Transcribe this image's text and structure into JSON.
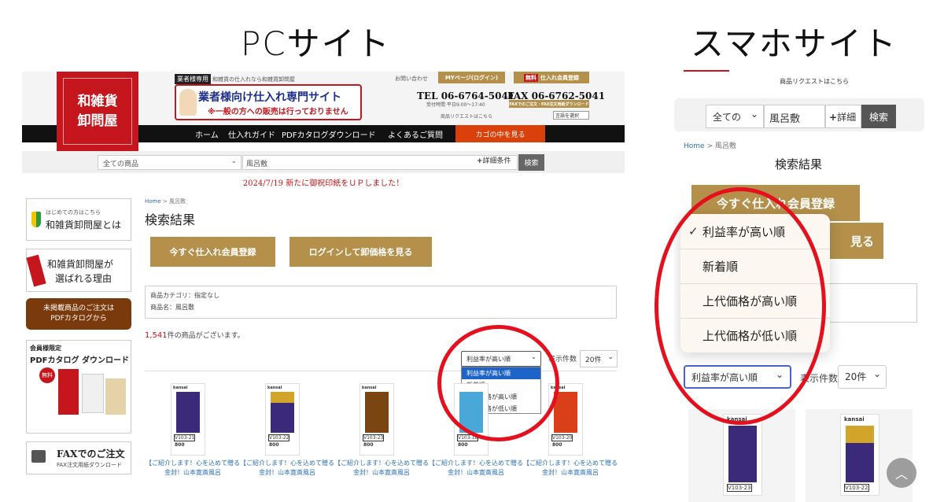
{
  "headings": {
    "pc": "PCサイト",
    "mobile": "スマホサイト"
  },
  "pc": {
    "logo": {
      "line1": "和雑貨",
      "line2": "卸問屋"
    },
    "header": {
      "badge": "業者様専用",
      "tagline": "和雑貨の仕入れなら和雑貨卸問屋",
      "banner_title": "業者様向け仕入れ専門サイト",
      "banner_sub": "※一般の方への販売は行っておりません",
      "inquiry": "お問い合わせ",
      "mypage_button": "MYページ(ログイン)",
      "register_button": "仕入れ会員登録",
      "free_badge": "無料",
      "tel": "TEL 06-6764-5041",
      "fax": "FAX 06-6762-5041",
      "hours": "受付時間 平日9:00〜17:40",
      "fax_order": "FAXでのご注文・FAX注文用紙ダウンロード",
      "request": "商品リクエストはこちら",
      "language": "言語を選択"
    },
    "nav": [
      "ホーム",
      "仕入れガイド",
      "PDFカタログダウンロード",
      "よくあるご質問"
    ],
    "cart_button": "カゴの中を見る",
    "search": {
      "category": "全ての商品",
      "keyword": "風呂敷",
      "detail": "詳細条件",
      "button": "検索"
    },
    "notice": "2024/7/19 新たに御祝印紙をＵＰしました！",
    "sidebar": {
      "beginner_small": "はじめての方はこちら",
      "beginner_title": "和雑貨卸問屋とは",
      "reason_line1": "和雑貨卸問屋が",
      "reason_line2": "選ばれる理由",
      "unlisted_line1": "未掲載商品のご注文は",
      "unlisted_line2": "PDFカタログから",
      "members_only": "会員様限定",
      "pdf_download": "PDFカタログ ダウンロード",
      "free_badge": "無料",
      "fax_title": "FAXでのご注文",
      "fax_sub": "FAX注文用紙ダウンロード"
    },
    "main": {
      "breadcrumb_home": "Home",
      "breadcrumb_sep": ">",
      "breadcrumb_current": "風呂敷",
      "title": "検索結果",
      "register_button": "今すぐ仕入れ会員登録",
      "login_button": "ログインして卸価格を見る",
      "category_line": "商品カテゴリ：指定なし",
      "name_line": "商品名：風呂敷",
      "count": "1,541",
      "count_suffix": "件の商品がございます。",
      "sort_selected": "利益率が高い順",
      "sort_options": [
        "利益率が高い順",
        "新着順",
        "上代価格が高い順",
        "上代価格が低い順"
      ],
      "per_page_label": "表示件数",
      "per_page_value": "20件"
    },
    "products": [
      {
        "code": "V103-21",
        "price": "800",
        "caption": "【ご紹介します！心を込めて贈る金封！山本寛斎風呂"
      },
      {
        "code": "V103-22",
        "price": "800",
        "caption": "【ご紹介します！心を込めて贈る金封！山本寛斎風呂"
      },
      {
        "code": "V103-23",
        "price": "800",
        "caption": "【ご紹介します！心を込めて贈る金封！山本寛斎風呂"
      },
      {
        "code": "V103-18",
        "price": "800",
        "caption": "【ご紹介します！心を込めて贈る金封！山本寛斎風呂"
      },
      {
        "code": "V103-20",
        "price": "800",
        "caption": "【ご紹介します！心を込めて贈る金封！山本寛斎風呂"
      }
    ],
    "brand": "kansai"
  },
  "mobile": {
    "request": "商品リクエストはこちら",
    "search": {
      "category": "全ての",
      "keyword": "風呂敷",
      "detail": "詳細",
      "button": "検索"
    },
    "breadcrumb_home": "Home",
    "breadcrumb_sep": ">",
    "breadcrumb_current": "風呂敷",
    "title": "検索結果",
    "register_button": "今すぐ仕入れ会員登録",
    "login_button_tail": "見る",
    "sort_options": [
      "利益率が高い順",
      "新着順",
      "上代価格が高い順",
      "上代価格が低い順"
    ],
    "checkmark": "✓",
    "sort_selected": "利益率が高い順",
    "per_page_label": "表示件数",
    "per_page_value": "20件",
    "products": [
      {
        "code": "V103-23"
      },
      {
        "code": "V103-22"
      }
    ],
    "brand": "kansai"
  },
  "colors": {
    "accent_red": "#c4161c",
    "gold": "#b4904a",
    "annotation_red": "#e5101d",
    "link_blue": "#2a6fb5"
  }
}
